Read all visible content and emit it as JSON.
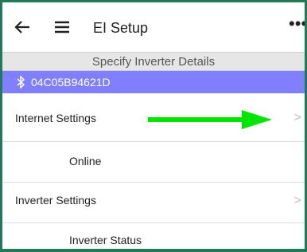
{
  "appbar": {
    "title": "EI Setup",
    "back_icon": "arrow-left-icon",
    "menu_icon": "hamburger-menu-icon",
    "more": "•••"
  },
  "subheader": {
    "text": "Specify Inverter Details"
  },
  "device": {
    "icon": "bluetooth-icon",
    "address": "04C05B94621D"
  },
  "rows": [
    {
      "label": "Internet Settings",
      "chevron": ">"
    },
    {
      "label": "Online"
    },
    {
      "label": "Inverter Settings",
      "chevron": ">"
    },
    {
      "label": "Inverter Status"
    }
  ],
  "annotation": {
    "arrow_color": "#00e600"
  },
  "colors": {
    "frame": "#1f7a5a",
    "device_bar": "#7f7fff",
    "subheader_bg": "#e6e6e6"
  }
}
